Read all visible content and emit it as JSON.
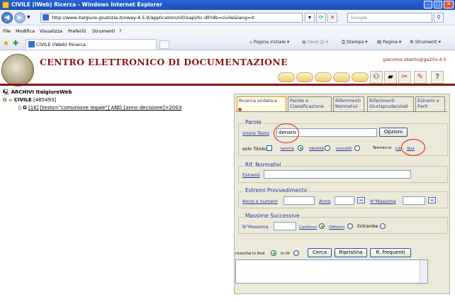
{
  "window": {
    "title": "CIVILE (IWeb) Ricerca - Windows Internet Explorer",
    "url": "http://www.italgiure.giustizia.it/xway-4.5.9/application/nif/isapi/hc.dll?db=civile&lang=it",
    "search_placeholder": "Google"
  },
  "menu": [
    "File",
    "Modifica",
    "Visualizza",
    "Preferiti",
    "Strumenti",
    "?"
  ],
  "tab": {
    "label": "CIVILE (IWeb) Ricerca"
  },
  "toolbar": {
    "home": "Pagina iniziale",
    "feed": "Feed (J)",
    "print": "Stampa",
    "page": "Pagina",
    "tools": "Strumenti"
  },
  "header": {
    "title": "CENTRO ELETTRONICO DI DOCUMENTAZIONE",
    "user": "giacomo.oberto@ga20",
    "version": "v.4.5"
  },
  "tree": {
    "root": "ARCHIVI ItalgiureWeb",
    "archive": "CIVILE",
    "archive_count": "[485493]",
    "query_letter": "G",
    "query_count": "[16]",
    "query": "[testo=\"comunione legale\"] AND [anno decisione]=2003"
  },
  "panel": {
    "tabs": [
      "Ricerca sintetica",
      "Parole e Classificazione",
      "Riferimenti Normativi",
      "Riferimenti Giurisprudenziali",
      "Estremi e Parti"
    ],
    "parole": {
      "legend": "Parole",
      "field_label": "intero Testo",
      "field_value": "denaro",
      "options_button": "Opzioni",
      "solo_titolo": "solo Titolo",
      "lemma": "lemma",
      "identita": "identità",
      "concetti": "concetti",
      "termini_in": "Termini in",
      "link1": "Lib",
      "link2": "Test"
    },
    "rif_normativi": {
      "legend": "Rif. Normativi",
      "estremi": "Estremi"
    },
    "provvedimento": {
      "legend": "Estremi Provvedimento",
      "anno_numero": "Anno e numero",
      "anno": "Anno",
      "nmassima": "N°Massima"
    },
    "massime": {
      "legend": "Massime Successive",
      "nmassima": "N°Massima",
      "conformi": "Conformi",
      "difformi": "Difformi",
      "entrambe": "Entrambe"
    },
    "bottom": {
      "and_label": "ricerche in And",
      "or_label": "in Or",
      "cerca": "Cerca",
      "ripristina": "Ripristina",
      "frequenti": "R. frequenti"
    }
  },
  "colors": {
    "brand": "#8a1414",
    "link": "#1d38a0",
    "annotation": "#e0141c"
  }
}
